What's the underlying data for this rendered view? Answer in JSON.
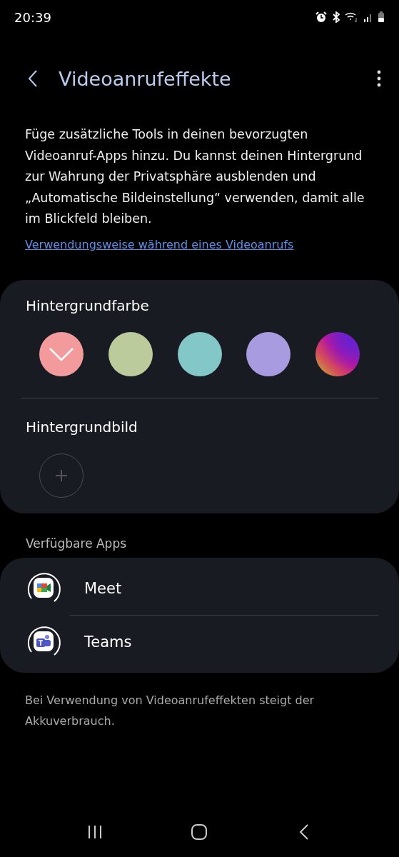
{
  "status_bar": {
    "time": "20:39"
  },
  "header": {
    "title": "Videoanrufeffekte"
  },
  "description": "Füge zusätzliche Tools in deinen bevorzugten Videoanruf-Apps hinzu. Du kannst deinen Hintergrund zur Wahrung der Privatsphäre ausblenden und „Automatische Bildeinstellung“ verwenden, damit alle im Blickfeld bleiben.",
  "link": "Verwendungsweise während eines Videoanrufs",
  "background_color": {
    "label": "Hintergrundfarbe",
    "swatches": [
      {
        "kind": "solid",
        "color": "#f29a9c",
        "selected": true
      },
      {
        "kind": "solid",
        "color": "#bccb9c",
        "selected": false
      },
      {
        "kind": "solid",
        "color": "#83c7c8",
        "selected": false
      },
      {
        "kind": "solid",
        "color": "#a99be0",
        "selected": false
      },
      {
        "kind": "gradient",
        "selected": false
      }
    ]
  },
  "background_image": {
    "label": "Hintergrundbild"
  },
  "apps_section": {
    "label": "Verfügbare Apps",
    "apps": [
      {
        "kind": "meet",
        "name": "Meet"
      },
      {
        "kind": "teams",
        "name": "Teams"
      }
    ]
  },
  "footer_note": "Bei Verwendung von Videoanrufeffekten steigt der Akkuverbrauch."
}
